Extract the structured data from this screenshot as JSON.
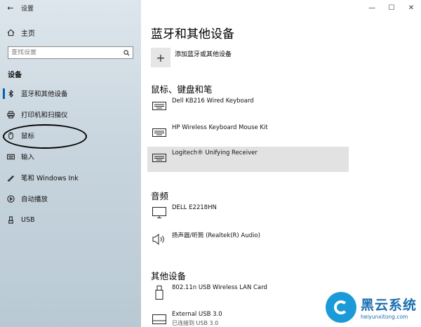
{
  "window": {
    "title": "设置",
    "controls": [
      "—",
      "☐",
      "✕"
    ]
  },
  "sidebar": {
    "back_glyph": "←",
    "home_label": "主页",
    "search_placeholder": "查找设置",
    "section_title": "设备",
    "items": [
      {
        "label": "蓝牙和其他设备",
        "icon": "bluetooth-icon",
        "active": true
      },
      {
        "label": "打印机和扫描仪",
        "icon": "printer-icon",
        "active": false
      },
      {
        "label": "鼠标",
        "icon": "mouse-icon",
        "active": false
      },
      {
        "label": "输入",
        "icon": "keyboard-icon",
        "active": false
      },
      {
        "label": "笔和 Windows Ink",
        "icon": "pen-icon",
        "active": false
      },
      {
        "label": "自动播放",
        "icon": "autoplay-icon",
        "active": false
      },
      {
        "label": "USB",
        "icon": "usb-icon",
        "active": false
      }
    ]
  },
  "main": {
    "page_title": "蓝牙和其他设备",
    "add_label": "添加蓝牙或其他设备",
    "groups": {
      "keyboard": {
        "title": "鼠标、键盘和笔",
        "devices": [
          {
            "name": "Dell KB216 Wired Keyboard",
            "icon": "keyboard-icon"
          },
          {
            "name": "HP Wireless Keyboard Mouse Kit",
            "icon": "keyboard-icon"
          },
          {
            "name": "Logitech® Unifying Receiver",
            "icon": "keyboard-icon",
            "selected": true
          }
        ]
      },
      "audio": {
        "title": "音频",
        "devices": [
          {
            "name": "DELL E2218HN",
            "icon": "monitor-icon"
          },
          {
            "name": "扬声器/听筒 (Realtek(R) Audio)",
            "icon": "speaker-icon"
          }
        ]
      },
      "other": {
        "title": "其他设备",
        "devices": [
          {
            "name": "802.11n USB Wireless LAN Card",
            "icon": "usb-device-icon"
          },
          {
            "name": "External USB 3.0",
            "status": "已连接到 USB 3.0",
            "icon": "usb-drive-icon"
          }
        ]
      }
    }
  },
  "watermark": {
    "name": "黑云系统",
    "url": "heiyunxitong.com"
  }
}
